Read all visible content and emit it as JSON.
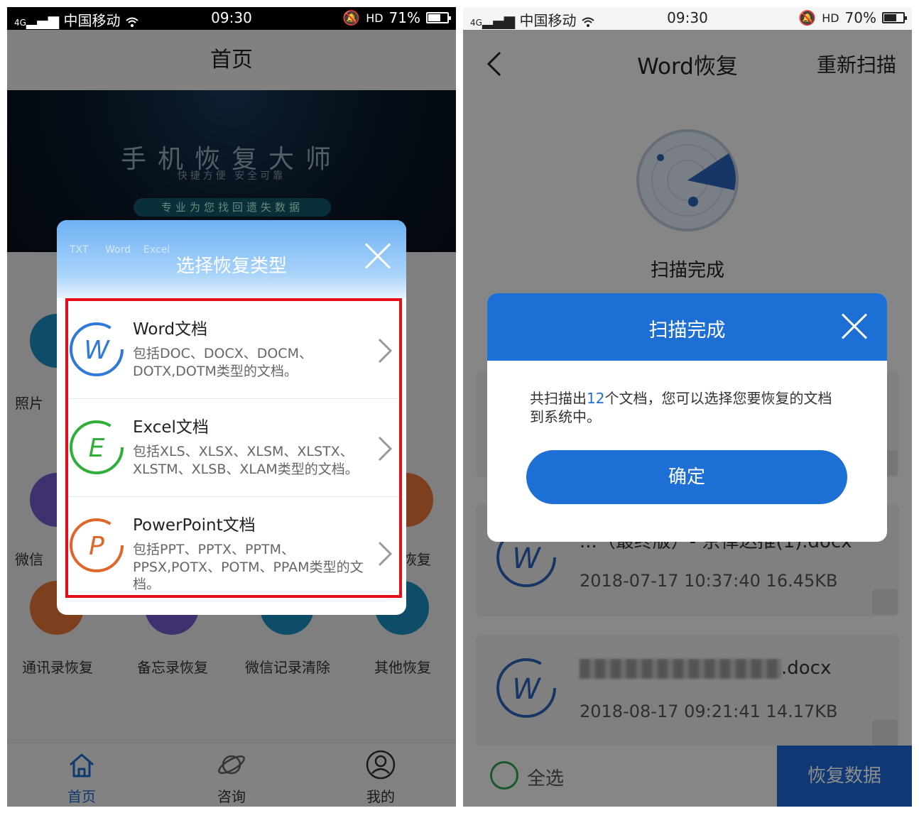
{
  "left": {
    "status": {
      "carrier": "中国移动",
      "time": "09:30",
      "battery": "71%",
      "battery_level": 0.71
    },
    "title": "首页",
    "banner": {
      "title": "手机恢复大师",
      "subtitle": "快捷方便  安全可靠",
      "pill": "专业为您找回遗失数据"
    },
    "grid_partial": {
      "photo": "照片",
      "wechat": "微信",
      "record_recover": "录恢复"
    },
    "grid_bottom": [
      "通讯录恢复",
      "备忘录恢复",
      "微信记录清除",
      "其他恢复"
    ],
    "tabs": [
      {
        "label": "首页",
        "icon": "home-icon"
      },
      {
        "label": "咨询",
        "icon": "planet-icon"
      },
      {
        "label": "我的",
        "icon": "user-icon"
      }
    ],
    "dialog": {
      "title": "选择恢复类型",
      "deco": [
        "TXT",
        "Word",
        "Excel"
      ],
      "items": [
        {
          "name": "Word文档",
          "desc": "包括DOC、DOCX、DOCM、DOTX,DOTM类型的文档。",
          "letter": "W",
          "color": "#2f7ad8"
        },
        {
          "name": "Excel文档",
          "desc": "包括XLS、XLSX、XLSM、XLSTX、XLSTM、XLSB、XLAM类型的文档。",
          "letter": "E",
          "color": "#2faf3a"
        },
        {
          "name": "PowerPoint文档",
          "desc": "包括PPT、PPTX、PPTM、PPSX,POTX、POTM、PPAM类型的文档。",
          "letter": "P",
          "color": "#e0652a"
        }
      ]
    }
  },
  "right": {
    "status": {
      "carrier": "中国移动",
      "time": "09:30",
      "battery": "70%",
      "battery_level": 0.7
    },
    "nav": {
      "title": "Word恢复",
      "action": "重新扫描"
    },
    "scan_status": "扫描完成",
    "files": [
      {
        "name": "...（最终版）- 京律达推(1).docx",
        "date": "2018-07-17 10:37:40",
        "size": "16.45KB"
      },
      {
        "name_suffix": ".docx",
        "date": "2018-08-17 09:21:41",
        "size": "14.17KB"
      }
    ],
    "select_all": "全选",
    "recover_button": "恢复数据",
    "dialog": {
      "title": "扫描完成",
      "text_before": "共扫描出",
      "count": "12",
      "text_after": "个文档，您可以选择您要恢复的文档到系统中。",
      "ok": "确定"
    }
  }
}
